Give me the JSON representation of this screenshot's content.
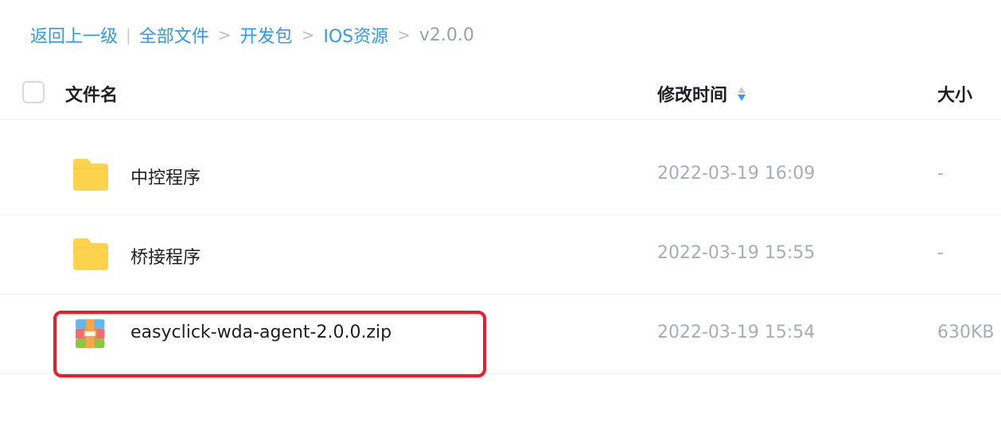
{
  "breadcrumb": {
    "back": "返回上一级",
    "separator_bar": "|",
    "separator": ">",
    "items": [
      "全部文件",
      "开发包",
      "IOS资源"
    ],
    "current": "v2.0.0"
  },
  "header": {
    "name": "文件名",
    "modified": "修改时间",
    "size": "大小",
    "sort_state": "descending"
  },
  "files": [
    {
      "name": "中控程序",
      "modified": "2022-03-19 16:09",
      "size": "-",
      "type": "folder",
      "icon": "folder-icon"
    },
    {
      "name": "桥接程序",
      "modified": "2022-03-19 15:55",
      "size": "-",
      "type": "folder",
      "icon": "folder-icon"
    },
    {
      "name": "easyclick-wda-agent-2.0.0.zip",
      "modified": "2022-03-19 15:54",
      "size": "630KB",
      "type": "zip",
      "icon": "zip-archive-icon",
      "highlighted": true
    }
  ],
  "colors": {
    "link": "#2f9af3",
    "highlight_border": "#ee1c25",
    "folder": "#fcd34d",
    "muted_text": "#a7adb5"
  }
}
